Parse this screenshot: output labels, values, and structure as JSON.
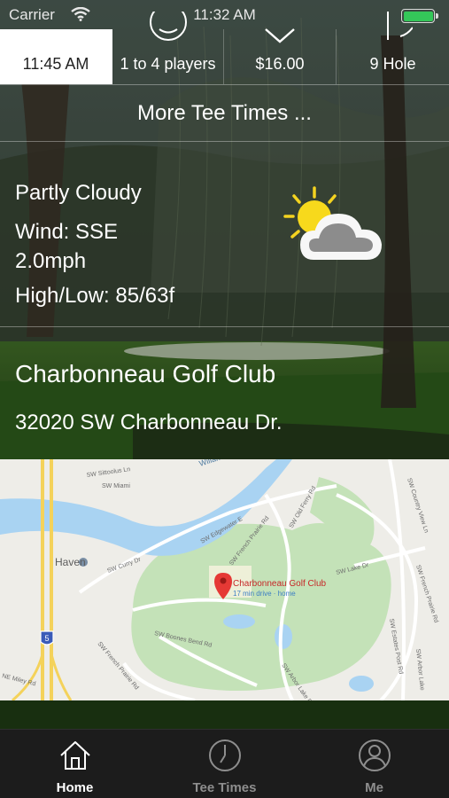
{
  "status_bar": {
    "carrier": "Carrier",
    "time": "11:32 AM",
    "battery_color": "#34c759"
  },
  "tee_time_options": [
    {
      "label": "11:45 AM",
      "icon": "clock-icon",
      "selected": true
    },
    {
      "label": "1 to 4 players",
      "icon": "players-icon",
      "selected": false
    },
    {
      "label": "$16.00",
      "icon": "chevron-down-icon",
      "selected": false
    },
    {
      "label": "9 Hole",
      "icon": "hole-flag-icon",
      "selected": false
    }
  ],
  "more_tee_times_label": "More Tee Times ...",
  "weather": {
    "condition": "Partly Cloudy",
    "wind": "Wind: SSE",
    "wind_speed": "2.0mph",
    "high_low": "High/Low: 85/63f",
    "icon": "partly-cloudy-icon"
  },
  "course": {
    "name": "Charbonneau Golf Club",
    "address": "32020 SW Charbonneau Dr."
  },
  "map": {
    "pin_title": "Charbonneau Golf Club",
    "pin_subtitle": "17 min drive · home",
    "place_label": "Haven",
    "river_label": "Willamette River",
    "highway_shield": "5",
    "streets": [
      "SW Miami",
      "SW Sittoolus Ln",
      "SW Edgewater E",
      "SW French Prairie Rd",
      "SW Old Ferry Rd",
      "SW Curry Dr",
      "SW Lake Dr",
      "SW Boones Bend Rd",
      "SW French Prairie Rd",
      "SW Arbor Lake Dr",
      "SW Country View Ln",
      "SW French Prairie Rd",
      "SW Estates Post Rd",
      "SW Arbor Lake",
      "NE Miley Rd"
    ]
  },
  "tabs": [
    {
      "label": "Home",
      "icon": "home-icon",
      "active": true
    },
    {
      "label": "Tee Times",
      "icon": "clock-icon",
      "active": false
    },
    {
      "label": "Me",
      "icon": "user-icon",
      "active": false
    }
  ]
}
